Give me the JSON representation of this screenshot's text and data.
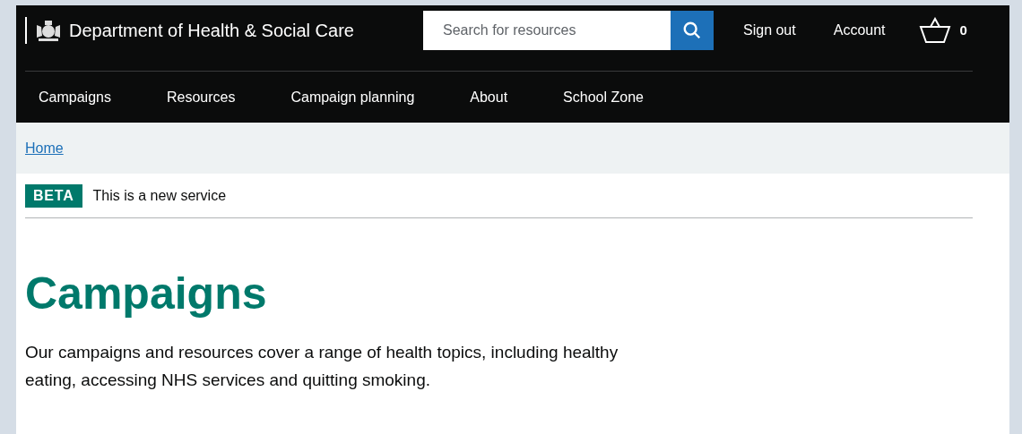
{
  "header": {
    "department": "Department of Health & Social Care",
    "search": {
      "placeholder": "Search for resources"
    },
    "links": [
      "Sign out",
      "Account"
    ],
    "basket_count": "0"
  },
  "nav": [
    "Campaigns",
    "Resources",
    "Campaign planning",
    "About",
    "School Zone"
  ],
  "breadcrumb": [
    "Home"
  ],
  "phase_banner": {
    "tag": "BETA",
    "text": "This is a new service"
  },
  "page": {
    "title": "Campaigns",
    "intro": "Our campaigns and resources cover a range of health topics, including healthy eating, accessing NHS services and quitting smoking."
  }
}
